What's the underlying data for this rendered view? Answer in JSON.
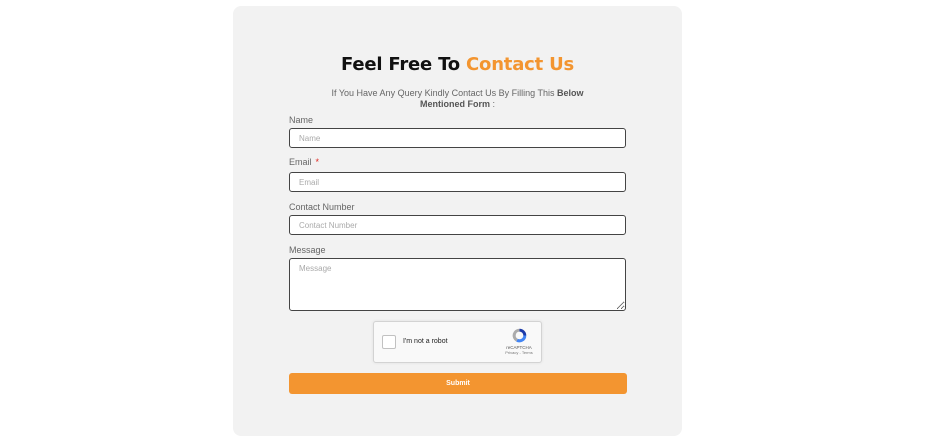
{
  "form": {
    "title_plain": "Feel Free To ",
    "title_accent": "Contact Us",
    "subtitle_plain": "If You Have Any Query Kindly Contact Us By Filling This ",
    "subtitle_bold": "Below Mentioned Form",
    "subtitle_tail": " :",
    "name": {
      "label": "Name",
      "placeholder": "Name",
      "value": ""
    },
    "email": {
      "label": "Email",
      "required_mark": "*",
      "placeholder": "Email",
      "value": ""
    },
    "contact": {
      "label": "Contact Number",
      "placeholder": "Contact Number",
      "value": ""
    },
    "message": {
      "label": "Message",
      "placeholder": "Message",
      "value": ""
    },
    "captcha": {
      "label": "I'm not a robot",
      "brand": "reCAPTCHA",
      "links": "Privacy - Terms",
      "checked": false
    },
    "submit_label": "Submit"
  },
  "colors": {
    "accent": "#f39530",
    "card_bg": "#f2f2f2",
    "required": "#e0261f"
  }
}
